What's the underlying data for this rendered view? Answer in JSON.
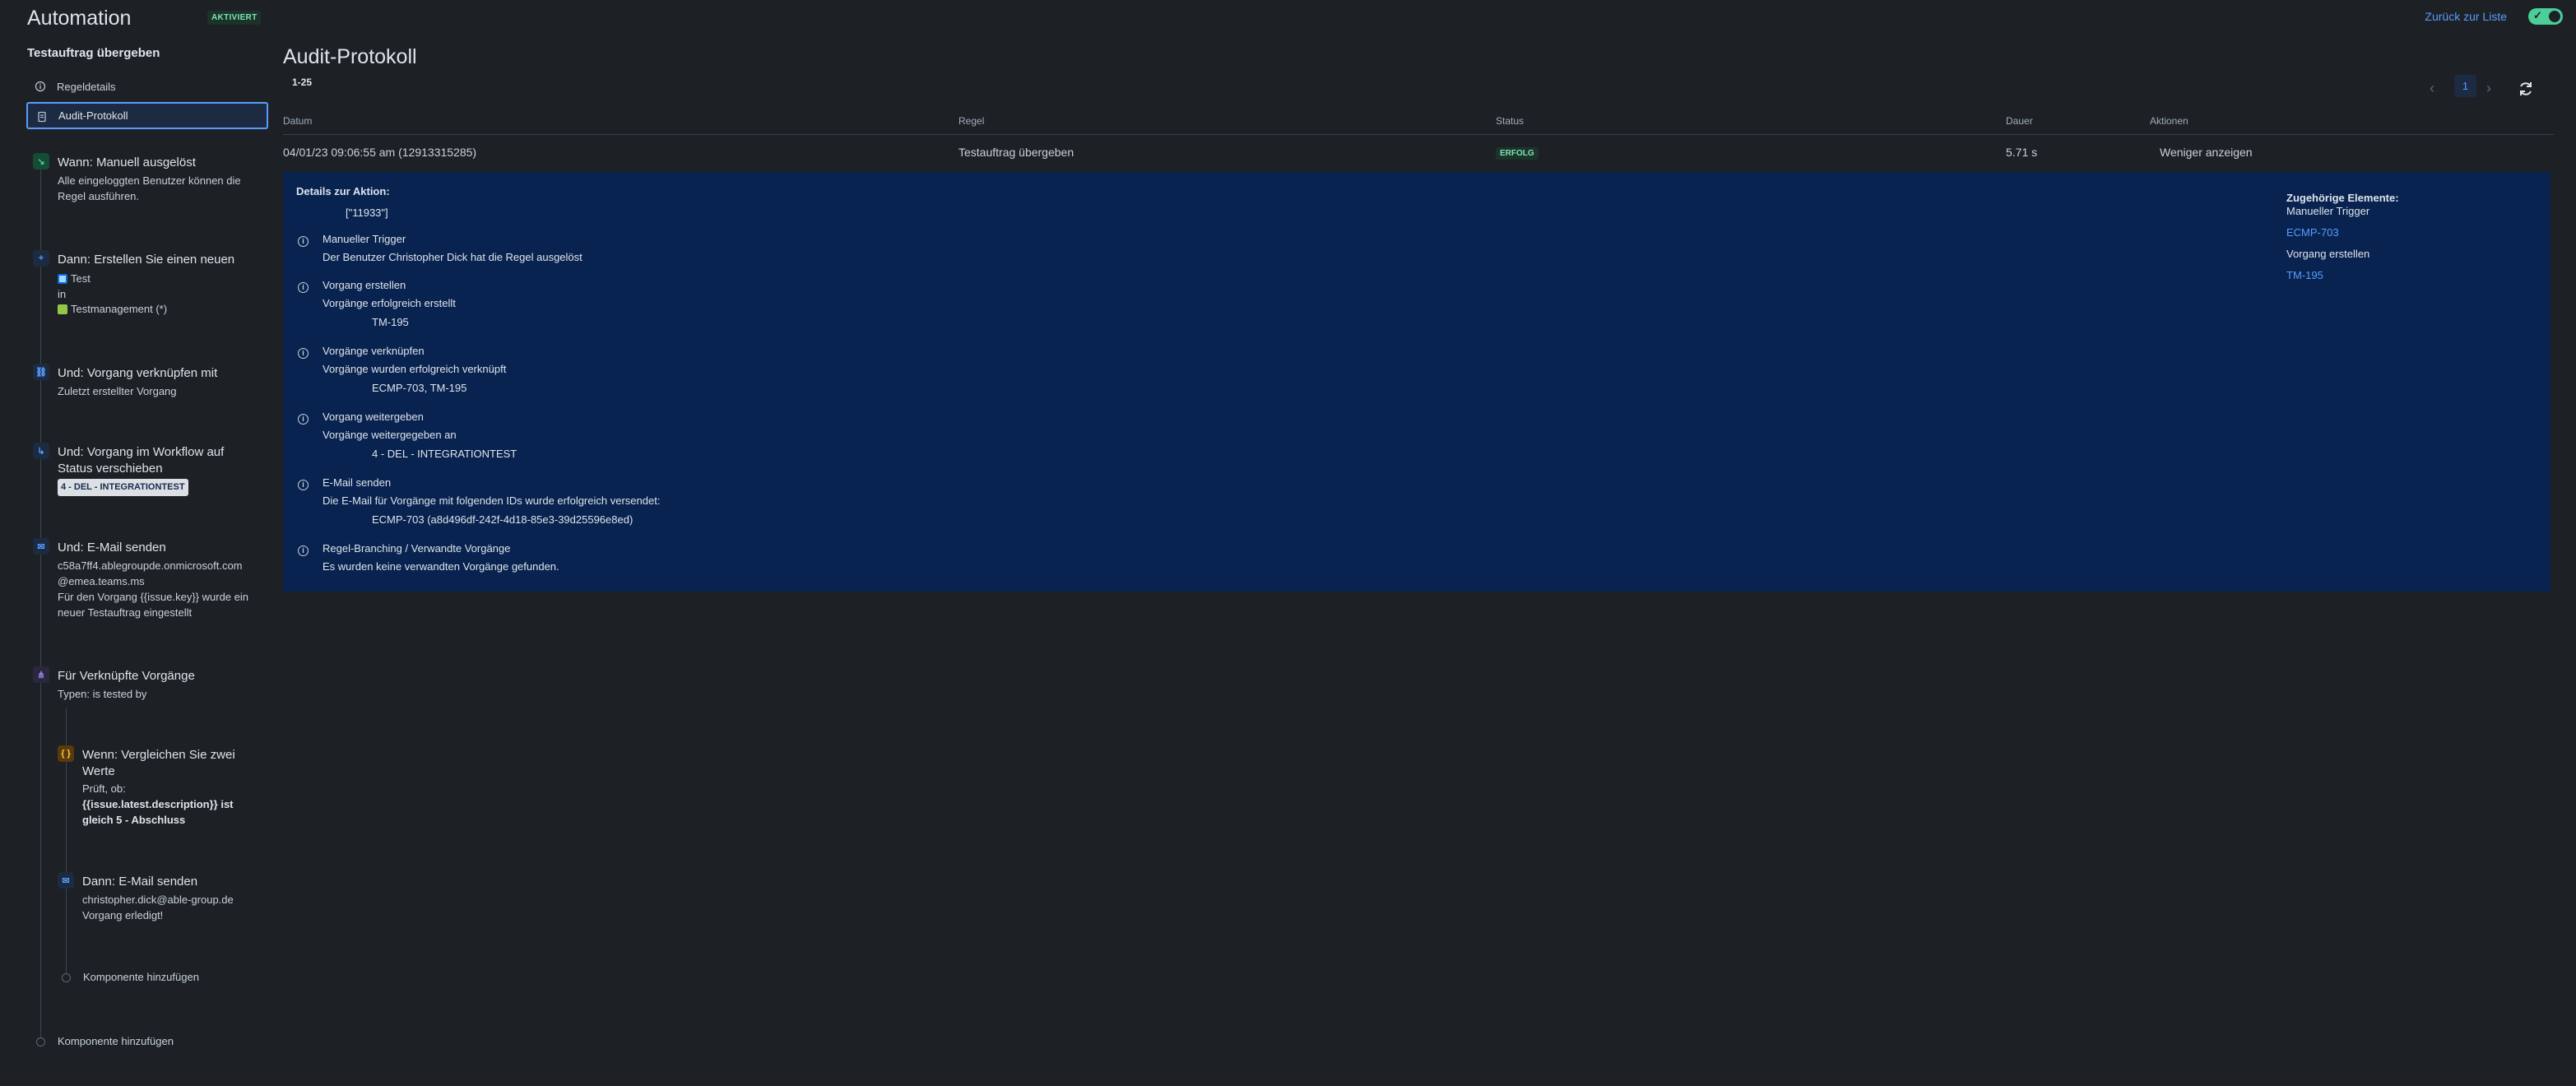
{
  "header": {
    "app_title": "Automation",
    "status_badge": "AKTIVIERT",
    "back_link": "Zurück zur Liste"
  },
  "sidebar": {
    "rule_name": "Testauftrag übergeben",
    "nav": [
      {
        "label": "Regeldetails",
        "icon": "info-icon"
      },
      {
        "label": "Audit-Protokoll",
        "icon": "document-icon"
      }
    ],
    "steps": {
      "trigger": {
        "title": "Wann: Manuell ausgelöst",
        "line1": "Alle eingeloggten Benutzer können die",
        "line2": "Regel ausführen."
      },
      "create": {
        "title": "Dann: Erstellen Sie einen neuen",
        "issue_type": "Test",
        "in": "in",
        "project": "Testmanagement (*)"
      },
      "link": {
        "title": "Und: Vorgang verknüpfen mit",
        "line1": "Zuletzt erstellter Vorgang"
      },
      "transition": {
        "title_line1": "Und: Vorgang im Workflow auf",
        "title_line2": "Status verschieben",
        "status_chip": "4 - DEL - INTEGRATIONTEST"
      },
      "email1": {
        "title": "Und: E-Mail senden",
        "line1": "c58a7ff4.ablegroupde.onmicrosoft.com",
        "line2": "@emea.teams.ms",
        "line3": "Für den Vorgang {{issue.key}} wurde ein",
        "line4": "neuer Testauftrag eingestellt"
      },
      "branch": {
        "title": "Für Verknüpfte Vorgänge",
        "line1": "Typen: is tested by"
      },
      "compare": {
        "title_line1": "Wenn: Vergleichen Sie zwei",
        "title_line2": "Werte",
        "line1": "Prüft, ob:",
        "line2": "{{issue.latest.description}} ist",
        "line3": "gleich 5 - Abschluss"
      },
      "email2": {
        "title": "Dann: E-Mail senden",
        "line1": "christopher.dick@able-group.de",
        "line2": "Vorgang erledigt!"
      },
      "add_inner": "Komponente hinzufügen",
      "add_outer": "Komponente hinzufügen"
    }
  },
  "main": {
    "title": "Audit-Protokoll",
    "range": "1-25",
    "page": "1",
    "columns": {
      "date": "Datum",
      "rule": "Regel",
      "status": "Status",
      "duration": "Dauer",
      "actions": "Aktionen"
    },
    "row": {
      "date": "04/01/23 09:06:55 am (12913315285)",
      "rule": "Testauftrag übergeben",
      "status": "ERFOLG",
      "duration": "5.71 s",
      "action": "Weniger anzeigen"
    },
    "details": {
      "label": "Details zur Aktion:",
      "value": "[\"11933\"]",
      "entries": [
        {
          "title": "Manueller Trigger",
          "text": "Der Benutzer Christopher Dick hat die Regel ausgelöst",
          "value": ""
        },
        {
          "title": "Vorgang erstellen",
          "text": "Vorgänge erfolgreich erstellt",
          "value": "TM-195"
        },
        {
          "title": "Vorgänge verknüpfen",
          "text": "Vorgänge wurden erfolgreich verknüpft",
          "value": "ECMP-703, TM-195"
        },
        {
          "title": "Vorgang weitergeben",
          "text": "Vorgänge weitergegeben an",
          "value": "4 - DEL - INTEGRATIONTEST"
        },
        {
          "title": "E-Mail senden",
          "text": "Die E-Mail für Vorgänge mit folgenden IDs wurde erfolgreich versendet:",
          "value": "ECMP-703 (a8d496df-242f-4d18-85e3-39d25596e8ed)"
        },
        {
          "title": "Regel-Branching / Verwandte Vorgänge",
          "text": "Es wurden keine verwandten Vorgänge gefunden.",
          "value": ""
        }
      ],
      "related_title": "Zugehörige Elemente:",
      "related": [
        {
          "text": "Manueller Trigger",
          "link": false
        },
        {
          "text": "ECMP-703",
          "link": true
        },
        {
          "text": "Vorgang erstellen",
          "link": false
        },
        {
          "text": "TM-195",
          "link": true
        }
      ]
    }
  },
  "colors": {
    "accent": "#579dff",
    "success": "#4bce97",
    "background": "#1d2125",
    "details_panel": "#092350"
  }
}
